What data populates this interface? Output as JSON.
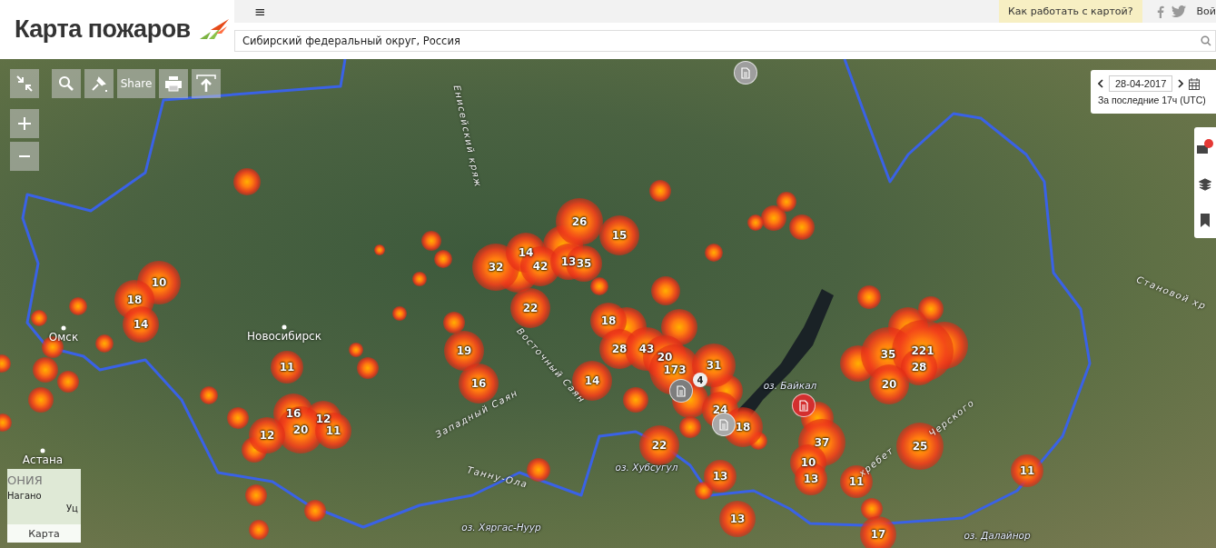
{
  "header": {
    "title": "Карта пожаров",
    "menu_icon": "≡",
    "help_button": "Как работать с картой?",
    "login": "Вой",
    "search": {
      "value": "Сибирский федеральный округ, Россия"
    }
  },
  "toolbar": {
    "share": "Share"
  },
  "date_panel": {
    "date": "28-04-2017",
    "period": "За последние 17ч (UTC)"
  },
  "map_labels": [
    {
      "text": "Омск",
      "kind": "city"
    },
    {
      "text": "Новосибирск",
      "kind": "city"
    },
    {
      "text": "Астана",
      "kind": "city"
    },
    {
      "text": "Енисейский кряж",
      "kind": "range"
    },
    {
      "text": "Западный Саян",
      "kind": "range"
    },
    {
      "text": "Восточный Саян",
      "kind": "range"
    },
    {
      "text": "Танну-Ола",
      "kind": "range"
    },
    {
      "text": "хребет",
      "kind": "range"
    },
    {
      "text": "Черского",
      "kind": "range"
    },
    {
      "text": "Становой хр",
      "kind": "range"
    },
    {
      "text": "оз. Байкал",
      "kind": "lake"
    },
    {
      "text": "оз. Хубсугул",
      "kind": "lake"
    },
    {
      "text": "оз. Хяргас-Нуур",
      "kind": "lake"
    },
    {
      "text": "оз. Далайнор",
      "kind": "lake"
    }
  ],
  "clusters": [
    {
      "count": "10"
    },
    {
      "count": "18"
    },
    {
      "count": "14"
    },
    {
      "count": "32"
    },
    {
      "count": "14"
    },
    {
      "count": "42"
    },
    {
      "count": "13"
    },
    {
      "count": "35"
    },
    {
      "count": "26"
    },
    {
      "count": "15"
    },
    {
      "count": "22"
    },
    {
      "count": "18"
    },
    {
      "count": "28"
    },
    {
      "count": "43"
    },
    {
      "count": "20"
    },
    {
      "count": "173"
    },
    {
      "count": "31"
    },
    {
      "count": "14"
    },
    {
      "count": "24"
    },
    {
      "count": "18"
    },
    {
      "count": "22"
    },
    {
      "count": "11"
    },
    {
      "count": "19"
    },
    {
      "count": "16"
    },
    {
      "count": "16"
    },
    {
      "count": "12"
    },
    {
      "count": "20"
    },
    {
      "count": "12"
    },
    {
      "count": "11"
    },
    {
      "count": "35"
    },
    {
      "count": "221"
    },
    {
      "count": "28"
    },
    {
      "count": "20"
    },
    {
      "count": "37"
    },
    {
      "count": "10"
    },
    {
      "count": "13"
    },
    {
      "count": "11"
    },
    {
      "count": "25"
    },
    {
      "count": "13"
    },
    {
      "count": "13"
    },
    {
      "count": "17"
    },
    {
      "count": "11"
    }
  ],
  "doc_markers": [
    {
      "color": "#9e9e9e"
    },
    {
      "color": "#7d7d7d",
      "badge": "4"
    },
    {
      "color": "#a8a8a8"
    },
    {
      "color": "#d32f2f"
    }
  ],
  "minimap": {
    "label": "Карта",
    "labels": [
      "ОНИЯ",
      "Нагано",
      "Уц"
    ]
  }
}
